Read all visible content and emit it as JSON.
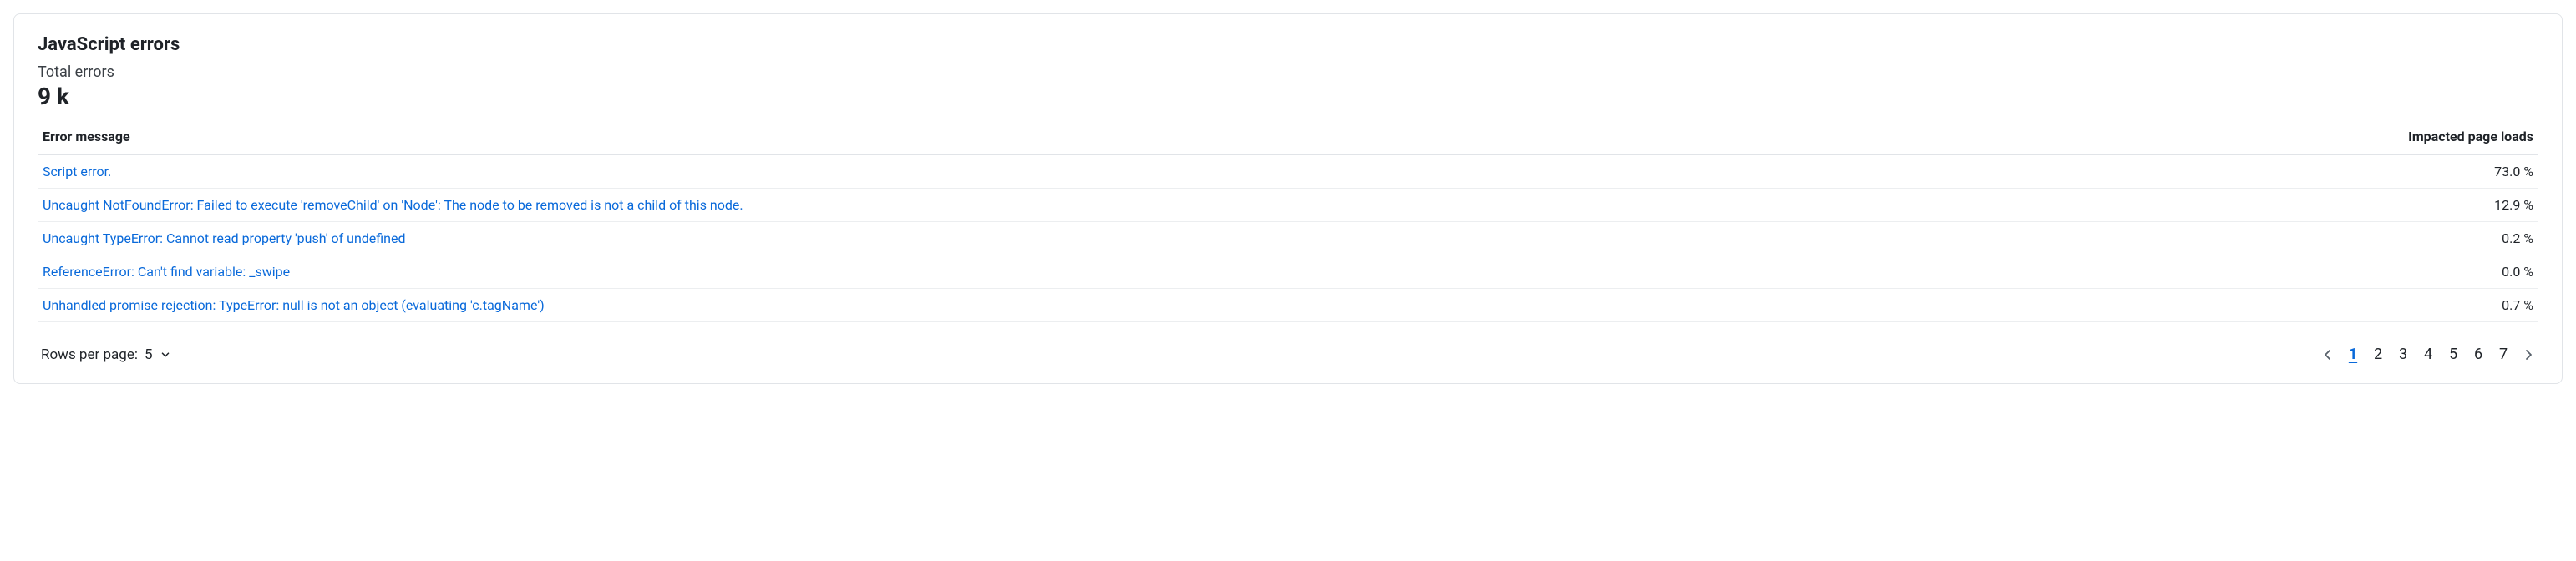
{
  "panel": {
    "title": "JavaScript errors",
    "total_label": "Total errors",
    "total_value": "9 k"
  },
  "table": {
    "headers": {
      "message": "Error message",
      "impacted": "Impacted page loads"
    },
    "rows": [
      {
        "message": "Script error.",
        "impacted": "73.0 %"
      },
      {
        "message": "Uncaught NotFoundError: Failed to execute 'removeChild' on 'Node': The node to be removed is not a child of this node.",
        "impacted": "12.9 %"
      },
      {
        "message": "Uncaught TypeError: Cannot read property 'push' of undefined",
        "impacted": "0.2 %"
      },
      {
        "message": "ReferenceError: Can't find variable: _swipe",
        "impacted": "0.0 %"
      },
      {
        "message": "Unhandled promise rejection: TypeError: null is not an object (evaluating 'c.tagName')",
        "impacted": "0.7 %"
      }
    ]
  },
  "pagination": {
    "rows_per_page_label": "Rows per page:",
    "rows_per_page_value": "5",
    "pages": [
      "1",
      "2",
      "3",
      "4",
      "5",
      "6",
      "7"
    ],
    "current_page": "1"
  }
}
